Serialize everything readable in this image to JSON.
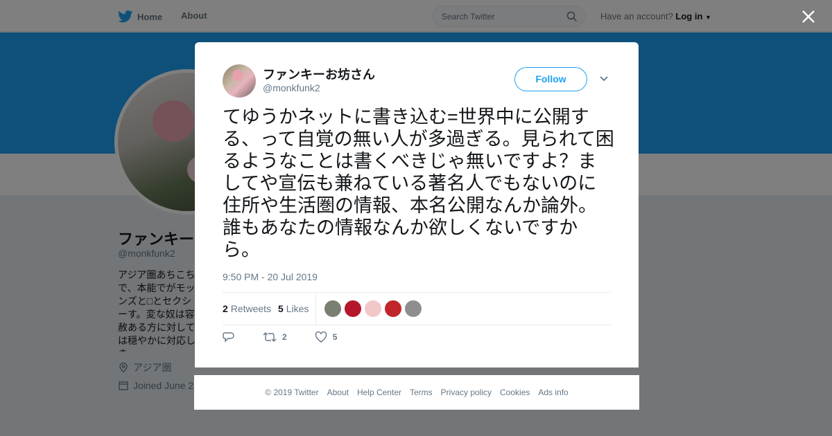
{
  "nav": {
    "home": "Home",
    "about": "About",
    "search_placeholder": "Search Twitter",
    "account_prompt": "Have an account?",
    "login": "Log in"
  },
  "profile": {
    "name": "ファンキー",
    "handle": "@monkfunk2",
    "bio": "アジア圏あちこちで、本能でがモッンズと□とセクシーす。変な奴は容赦ある方に対しては穏やかに対応しま",
    "location": "アジア圏",
    "joined": "Joined June 2"
  },
  "tweet": {
    "name": "ファンキーお坊さん",
    "handle": "@monkfunk2",
    "follow_label": "Follow",
    "text": "てゆうかネットに書き込む=世界中に公開する、って自覚の無い人が多過ぎる。見られて困るようなことは書くべきじゃ無いですよ？ましてや宣伝も兼ねている著名人でもないのに住所や生活圏の情報、本名公開なんか論外。誰もあなたの情報なんか欲しくないですから。",
    "timestamp": "9:50 PM - 20 Jul 2019",
    "retweets_count": "2",
    "retweets_label": "Retweets",
    "likes_count": "5",
    "likes_label": "Likes",
    "likers": [
      "#7a7f74",
      "#b5162b",
      "#f0c8c8",
      "#c0262a",
      "#8e8e8e"
    ],
    "action_retweet_count": "2",
    "action_like_count": "5"
  },
  "footer": {
    "links": [
      "© 2019 Twitter",
      "About",
      "Help Center",
      "Terms",
      "Privacy policy",
      "Cookies",
      "Ads info"
    ]
  }
}
